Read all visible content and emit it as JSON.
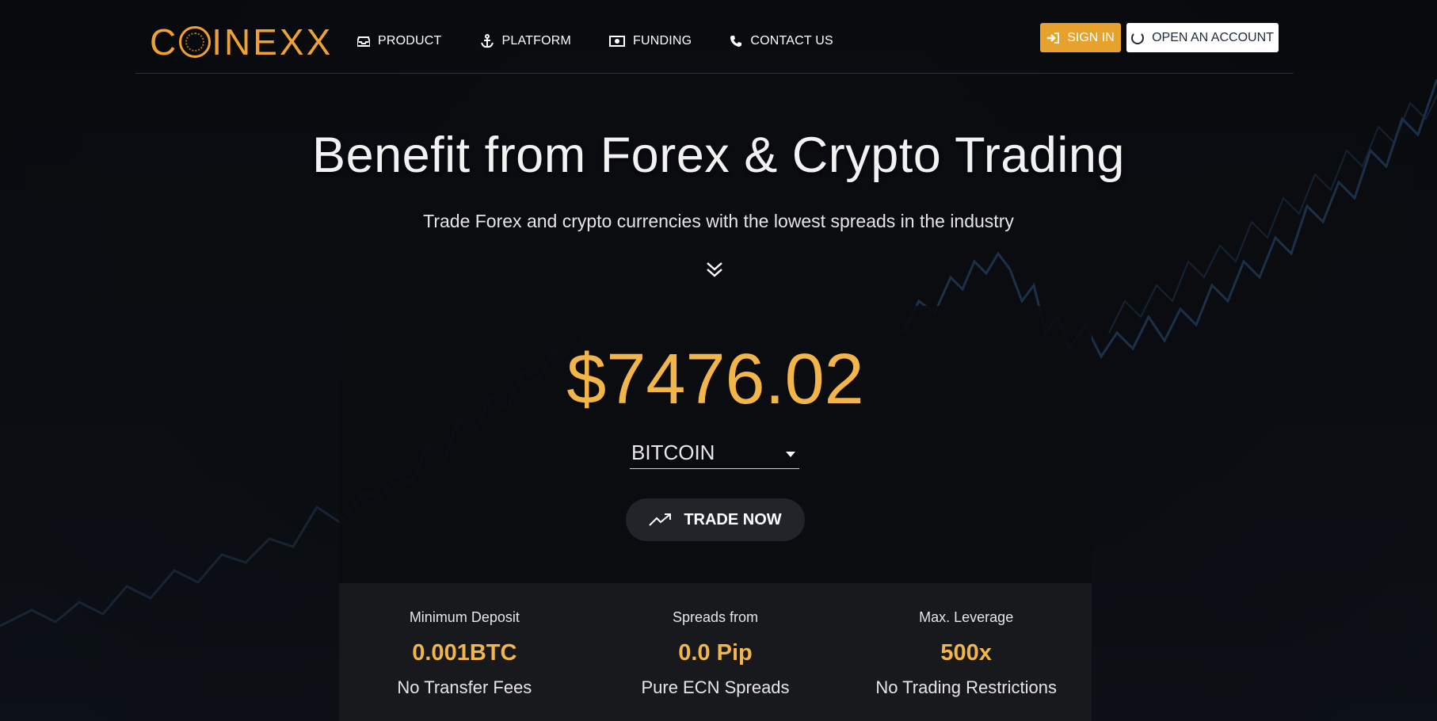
{
  "brand": {
    "name": "COINEXX",
    "accent_color": "#f0a132"
  },
  "nav": {
    "items": [
      {
        "label": "PRODUCT",
        "icon": "inbox-icon"
      },
      {
        "label": "PLATFORM",
        "icon": "anchor-icon"
      },
      {
        "label": "FUNDING",
        "icon": "money-icon"
      },
      {
        "label": "CONTACT US",
        "icon": "phone-icon"
      }
    ],
    "sign_in": "SIGN IN",
    "open_account": "OPEN AN ACCOUNT"
  },
  "hero": {
    "title": "Benefit from Forex & Crypto Trading",
    "subtitle": "Trade Forex and crypto currencies with the lowest spreads in the industry"
  },
  "trade": {
    "price": "$7476.02",
    "asset_selected": "BITCOIN",
    "button_label": "TRADE NOW"
  },
  "stats": [
    {
      "label": "Minimum Deposit",
      "value": "0.001BTC",
      "desc": "No Transfer Fees"
    },
    {
      "label": "Spreads from",
      "value": "0.0 Pip",
      "desc": "Pure ECN Spreads"
    },
    {
      "label": "Max. Leverage",
      "value": "500x",
      "desc": "No Trading Restrictions"
    }
  ]
}
